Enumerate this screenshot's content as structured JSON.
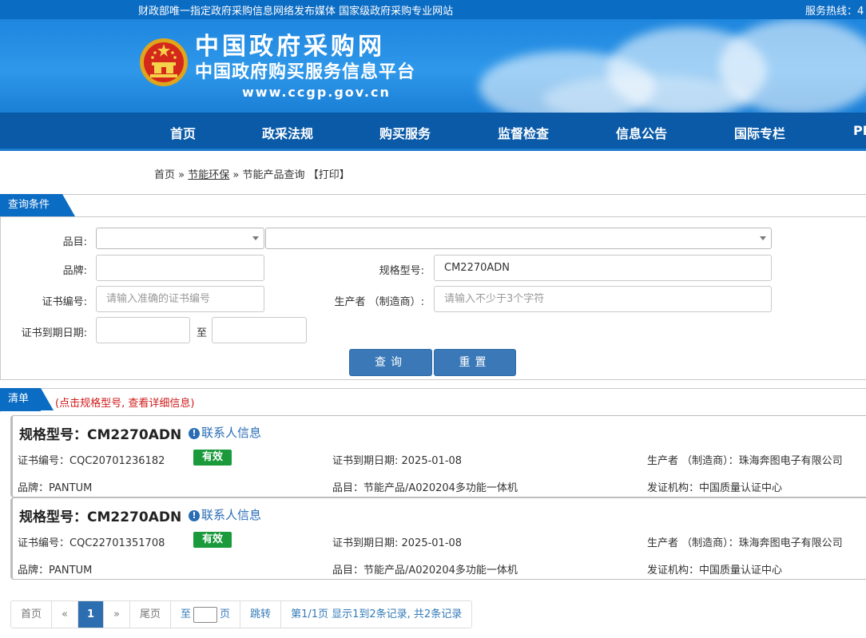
{
  "topbar": {
    "slogan": "财政部唯一指定政府采购信息网络发布媒体 国家级政府采购专业网站",
    "hotline": "服务热线：4"
  },
  "header": {
    "title": "中国政府采购网",
    "subtitle": "中国政府购买服务信息平台",
    "url": "www.ccgp.gov.cn"
  },
  "nav": [
    "首页",
    "政采法规",
    "购买服务",
    "监督检查",
    "信息公告",
    "国际专栏",
    "PP"
  ],
  "breadcrumb": {
    "home": "首页",
    "sep1": "»",
    "section": "节能环保",
    "sep2": "»",
    "current": "节能产品查询",
    "print": "【打印】"
  },
  "query": {
    "panel_title": "查询条件",
    "category_label": "品目:",
    "category_value": "",
    "subcategory_value": "",
    "brand_label": "品牌:",
    "brand_value": "",
    "model_label": "规格型号:",
    "model_value": "CM2270ADN",
    "cert_no_label": "证书编号:",
    "cert_no_placeholder": "请输入准确的证书编号",
    "maker_label": "生产者 （制造商）:",
    "maker_placeholder": "请输入不少于3个字符",
    "expiry_label": "证书到期日期:",
    "expiry_to": "至",
    "expiry_from_value": "",
    "expiry_to_value": "",
    "search_button": "查询",
    "reset_button": "重置"
  },
  "list": {
    "panel_title": "清单",
    "hint": "(点击规格型号, 查看详细信息)",
    "contact_label": "联系人信息",
    "items": [
      {
        "model": "规格型号：CM2270ADN",
        "cert_no": "证书编号：CQC20701236182",
        "status": "有效",
        "expiry": "证书到期日期: 2025-01-08",
        "maker": "生产者 （制造商）：珠海奔图电子有限公司",
        "brand": "品牌：PANTUM",
        "category": "品目：节能产品/A020204多功能一体机",
        "issuer": "发证机构：中国质量认证中心"
      },
      {
        "model": "规格型号：CM2270ADN",
        "cert_no": "证书编号：CQC22701351708",
        "status": "有效",
        "expiry": "证书到期日期: 2025-01-08",
        "maker": "生产者 （制造商）：珠海奔图电子有限公司",
        "brand": "品牌：PANTUM",
        "category": "品目：节能产品/A020204多功能一体机",
        "issuer": "发证机构：中国质量认证中心"
      }
    ]
  },
  "pager": {
    "first": "首页",
    "prev": "«",
    "current": "1",
    "next": "»",
    "last": "尾页",
    "goto_prefix": "至",
    "goto_suffix": "页",
    "jump": "跳转",
    "summary": "第1/1页  显示1到2条记录, 共2条记录"
  },
  "colors": {
    "brand_blue": "#0b6cc4",
    "nav_blue": "#0a5aa8",
    "valid_green": "#1a9a3a",
    "hint_red": "#d01a1a"
  }
}
